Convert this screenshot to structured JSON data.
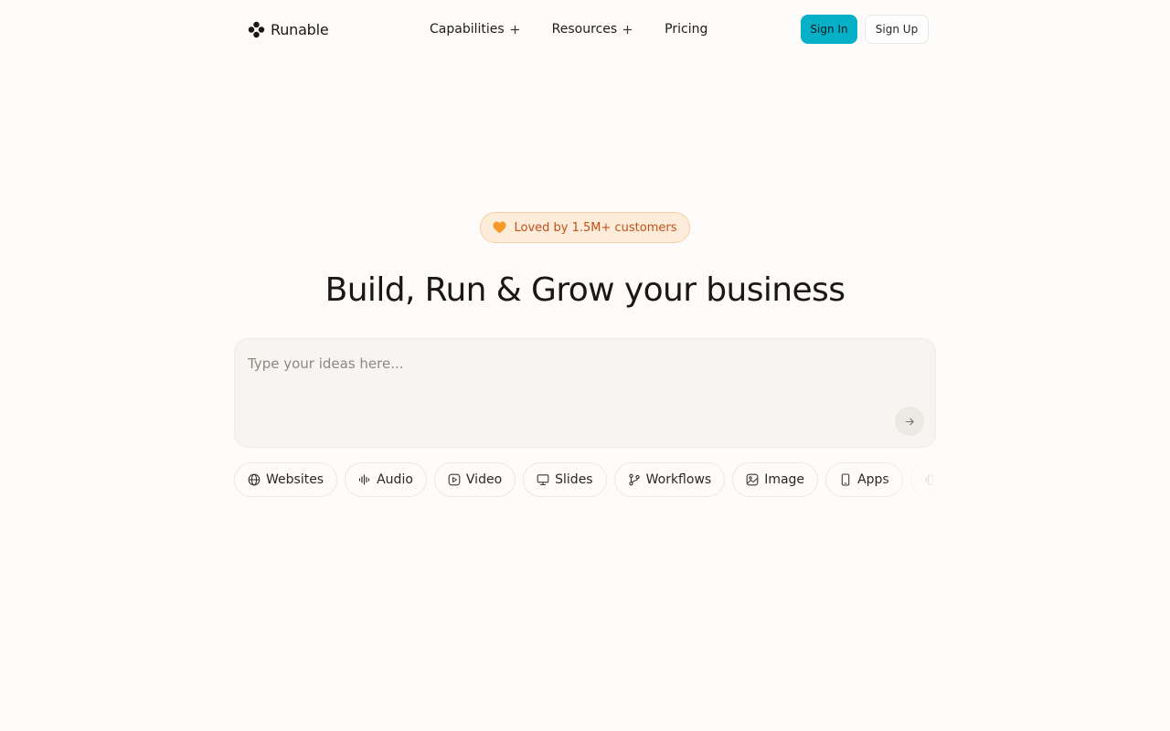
{
  "brand": {
    "name": "Runable",
    "accent_color": "#06b0c7"
  },
  "nav": {
    "items": [
      {
        "label": "Capabilities",
        "has_plus": true
      },
      {
        "label": "Resources",
        "has_plus": true
      },
      {
        "label": "Pricing",
        "has_plus": false
      }
    ]
  },
  "auth": {
    "sign_in_label": "Sign In",
    "sign_up_label": "Sign Up"
  },
  "hero": {
    "badge_icon": "orange-heart-icon",
    "badge_text": "Loved by 1.5M+ customers",
    "badge_text_color": "#c4501a",
    "headline": "Build, Run & Grow your business"
  },
  "prompt": {
    "value": "",
    "placeholder": "Type your ideas here...",
    "send_icon": "arrow-right-icon"
  },
  "chips": [
    {
      "label": "Websites",
      "icon": "globe-icon"
    },
    {
      "label": "Audio",
      "icon": "audio-wave-icon"
    },
    {
      "label": "Video",
      "icon": "video-play-icon"
    },
    {
      "label": "Slides",
      "icon": "presentation-icon"
    },
    {
      "label": "Workflows",
      "icon": "branch-icon"
    },
    {
      "label": "Image",
      "icon": "image-icon"
    },
    {
      "label": "Apps",
      "icon": "phone-icon"
    },
    {
      "label": "C",
      "icon": "vibrate-icon"
    }
  ]
}
